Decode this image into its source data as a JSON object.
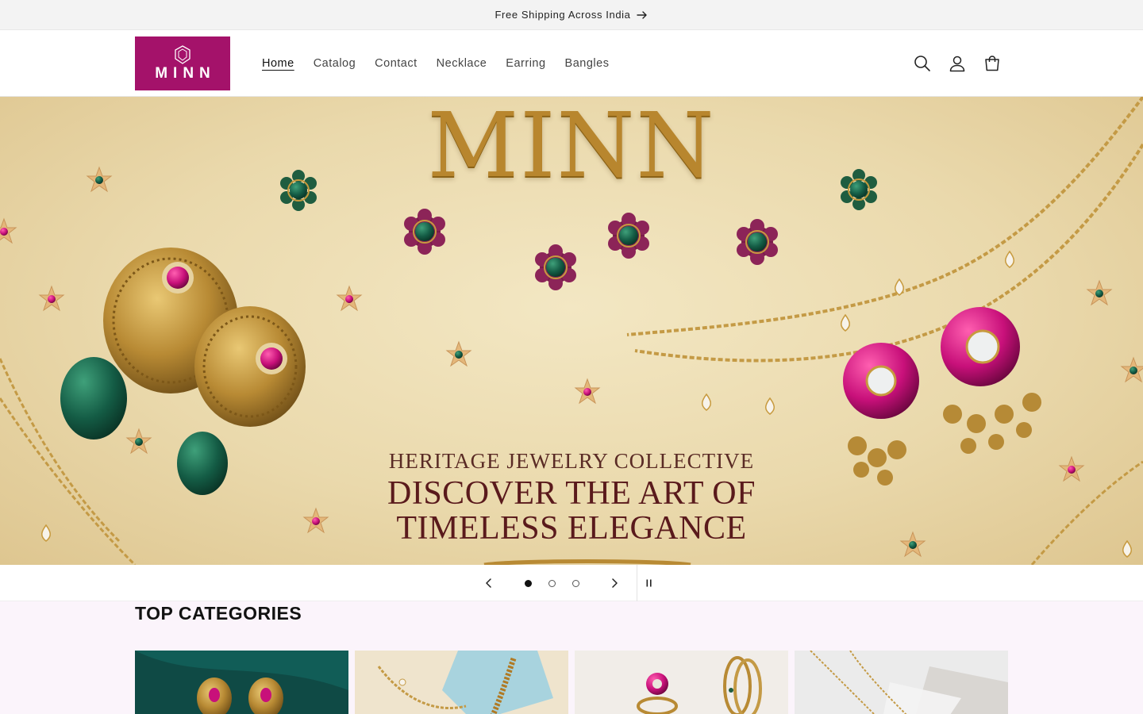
{
  "announcement": {
    "text": "Free Shipping Across India"
  },
  "header": {
    "logo_text": "MINN",
    "nav": [
      {
        "label": "Home",
        "active": true
      },
      {
        "label": "Catalog",
        "active": false
      },
      {
        "label": "Contact",
        "active": false
      },
      {
        "label": "Necklace",
        "active": false
      },
      {
        "label": "Earring",
        "active": false
      },
      {
        "label": "Bangles",
        "active": false
      }
    ],
    "icons": [
      "search-icon",
      "account-icon",
      "cart-icon"
    ]
  },
  "hero": {
    "brand": "MINN",
    "kicker": "HERITAGE JEWELRY COLLECTIVE",
    "headline_line1": "DISCOVER THE ART OF",
    "headline_line2": "TIMELESS ELEGANCE"
  },
  "slider": {
    "slide_count": 3,
    "current_slide": 1,
    "paused": false
  },
  "categories": {
    "title": "TOP CATEGORIES",
    "cards": [
      {
        "name": "earrings-category",
        "colors": [
          "#0f4a45",
          "#12625b"
        ]
      },
      {
        "name": "necklace-category",
        "colors": [
          "#efe4cd",
          "#a8d3de"
        ]
      },
      {
        "name": "rings-bangles-category",
        "colors": [
          "#f1ede8",
          "#e7e0d6"
        ]
      },
      {
        "name": "chain-category",
        "colors": [
          "#ebebeb",
          "#d9d6d2"
        ]
      }
    ]
  },
  "colors": {
    "brand": "#a4126a",
    "accent_gold": "#b8862e",
    "headline": "#5a1a1c",
    "category_bg": "#fbf4fb"
  }
}
